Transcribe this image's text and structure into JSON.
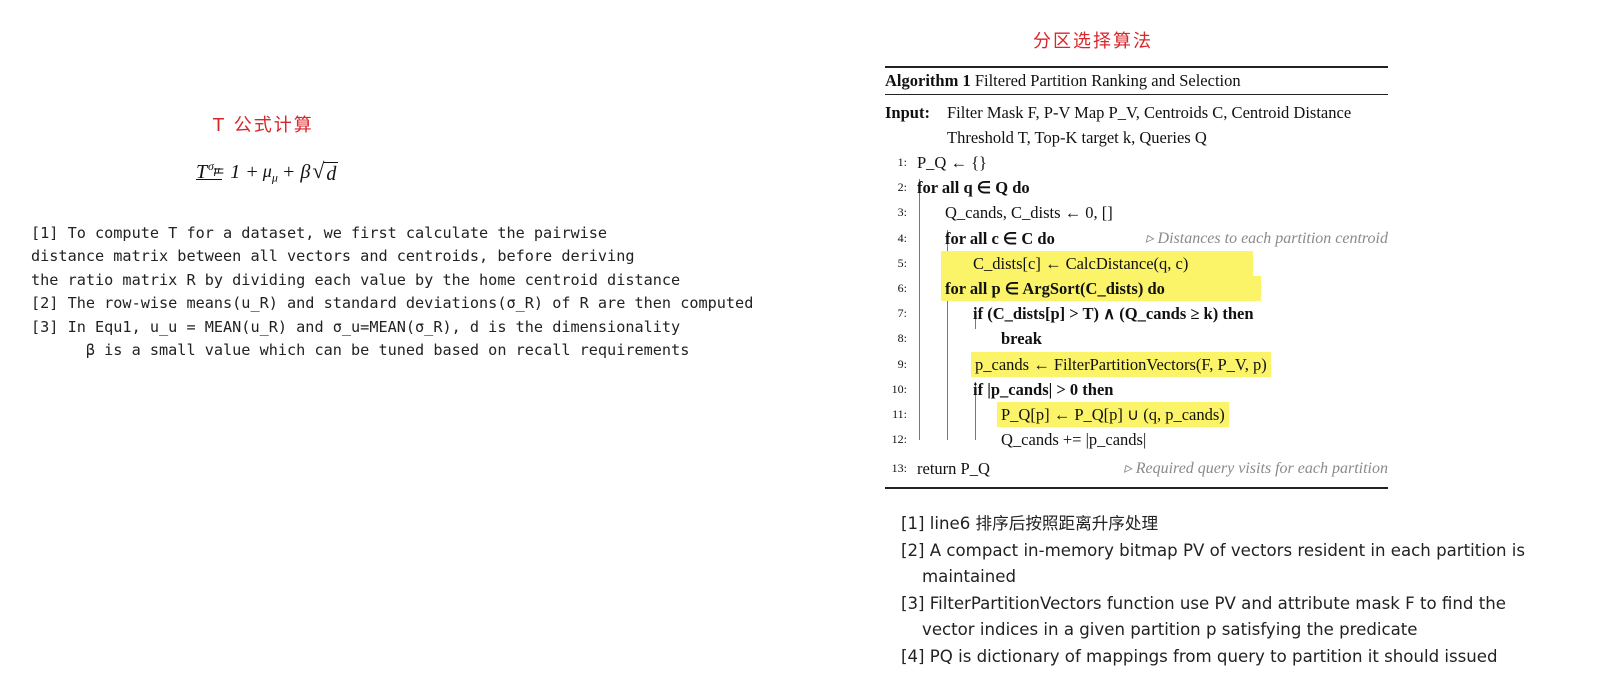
{
  "left": {
    "title": "T 公式计算",
    "formula": {
      "lhs": "T = 1 +",
      "num": "σ",
      "num_sub": "μ",
      "den": "μ",
      "den_sub": "μ",
      "plus": "+ β",
      "rad": "√",
      "under": "d"
    },
    "notes": [
      "[1] To compute T for a dataset, we first calculate the pairwise",
      "distance matrix between all vectors and centroids, before deriving",
      "the ratio matrix R by dividing each value by the home centroid distance",
      "[2] The row-wise means(u_R) and standard deviations(σ_R) of R are then computed",
      "[3] In Equ1, u_u = MEAN(u_R) and σ_u=MEAN(σ_R), d is the dimensionality",
      "      β is a small value which can be tuned based on recall requirements"
    ]
  },
  "right": {
    "title": "分区选择算法",
    "algorithm": {
      "label": "Algorithm 1",
      "name": "Filtered Partition Ranking and Selection",
      "input_key": "Input:",
      "input_line1": "Filter Mask F, P-V Map P_V, Centroids C, Centroid Distance",
      "input_line2": "Threshold T, Top-K target k, Queries Q",
      "lines": [
        {
          "n": "1:",
          "text": "P_Q ← {}"
        },
        {
          "n": "2:",
          "text": "for all q ∈ Q do"
        },
        {
          "n": "3:",
          "text": "Q_cands, C_dists ← 0, []"
        },
        {
          "n": "4:",
          "text": "for all c ∈ C do"
        },
        {
          "n": "5:",
          "text": "C_dists[c] ← CalcDistance(q, c)"
        },
        {
          "n": "6:",
          "text": "for all p ∈ ArgSort(C_dists) do"
        },
        {
          "n": "7:",
          "text": "if (C_dists[p] > T) ∧ (Q_cands ≥ k) then"
        },
        {
          "n": "8:",
          "text": "break"
        },
        {
          "n": "9:",
          "text": "p_cands ← FilterPartitionVectors(F, P_V, p)"
        },
        {
          "n": "10:",
          "text": "if |p_cands| > 0 then"
        },
        {
          "n": "11:",
          "text": "P_Q[p] ← P_Q[p] ∪ (q, p_cands)"
        },
        {
          "n": "12:",
          "text": "Q_cands += |p_cands|"
        },
        {
          "n": "13:",
          "text": "return P_Q"
        }
      ],
      "comment4": "▹ Distances to each partition centroid",
      "comment13": "▹ Required query visits for each partition"
    },
    "notes": [
      "[1] line6 排序后按照距离升序处理",
      "[2] A compact in-memory bitmap PV of vectors resident in each partition is maintained",
      "[3] FilterPartitionVectors function use PV and attribute mask F to find the vector indices in a given partition p satisfying the predicate",
      "[4] PQ is dictionary of mappings from query to partition it should issued"
    ]
  }
}
